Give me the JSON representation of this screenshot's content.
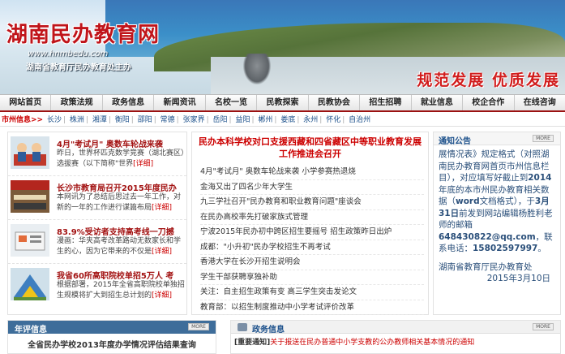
{
  "header": {
    "site_title": "湖南民办教育网",
    "url": "www.hnmbedu.com",
    "subtitle": "湖南省教育厅民办教育处主办",
    "slogan": "规范发展 优质发展"
  },
  "nav": [
    "网站首页",
    "政策法规",
    "政务信息",
    "新闻资讯",
    "名校一览",
    "民教探索",
    "民教协会",
    "招生招聘",
    "就业信息",
    "校企合作",
    "在线咨询"
  ],
  "citybar": {
    "lead": "市州信息>>",
    "cities": [
      "长沙",
      "株洲",
      "湘潭",
      "衡阳",
      "邵阳",
      "常德",
      "张家界",
      "岳阳",
      "益阳",
      "郴州",
      "娄底",
      "永州",
      "怀化",
      "自治州"
    ]
  },
  "left_news": [
    {
      "title": "4月\"考试月\" 奥数车轮战来袭",
      "desc": "昨日，世界杯匹克数学竞赛（湖北赛区）选拔赛（以下简称\"世界",
      "detail": "[详细]"
    },
    {
      "title": "长沙市教育局召开2015年度民办",
      "desc": "本网讯为了总结后思过去一年工作，对新的一年的工作进行谋篇布局",
      "detail": "[详细]"
    },
    {
      "title": "83.9%受访者支持高考线一刀撼",
      "desc": "漫画：华夹高考改革路动无数家长和学生的心，因为它带来的不仅是",
      "detail": "[详细]"
    },
    {
      "title": "我省60所高职院校单招5万人 考",
      "desc": "根据部署，2015年全省高职院校单独招生规模将扩大到招生总计划的",
      "detail": "[详细]"
    }
  ],
  "middle": {
    "headline": "民办本科学校对口支援西藏和四省藏区中等职业教育发展工作推进会召开",
    "items": [
      "4月\"考试月\" 奥数车轮战来袭 小学参赛热退烧",
      "金海又出了四名少年大学生",
      "九三学社召开\"民办教育和职业教育问题\"座谈会",
      "在民办高校率先打破家族式管理",
      "宁波2015年民办初中跨区招生要摇号 招生政策昨日出炉",
      "成都：\"小升初\"民办学校招生不再考试",
      "香港大学在长沙开招生说明会",
      "学生干部获聘享独补助",
      "关注：自主招生政策有变 高三学生突击发论文",
      "教育部：以招生制度推动中小学考试评价改革"
    ]
  },
  "notice": {
    "title": "通知公告",
    "more": "MORE",
    "lines": [
      "展情况表》规定格式（对照湖南民办教育网首页市州信息栏目），对应填写好截止到",
      "2014",
      "年底的本市州民办教育相关数据（",
      "word",
      "文档格式），于",
      "3月31日",
      "前发到网站编辑杨胜利老师的邮箱",
      "648430822@qq.com",
      "，联系电话：",
      "15802597997",
      "。"
    ],
    "sign": "湖南省教育厅民办教育处",
    "date": "2015年3月10日"
  },
  "bottom_left": {
    "title": "年评信息",
    "more": "MORE",
    "item": "全省民办学校2013年度办学情况评估结果查询"
  },
  "bottom_right": {
    "title": "政务信息",
    "more": "MORE",
    "tag": "[重要通知]",
    "item": "关于报送在民办普通中小学支教的公办教师相关基本情况的通知"
  },
  "colors": {
    "accent": "#c00000",
    "nav_border": "#9b1111",
    "link": "#1a4f8a"
  }
}
